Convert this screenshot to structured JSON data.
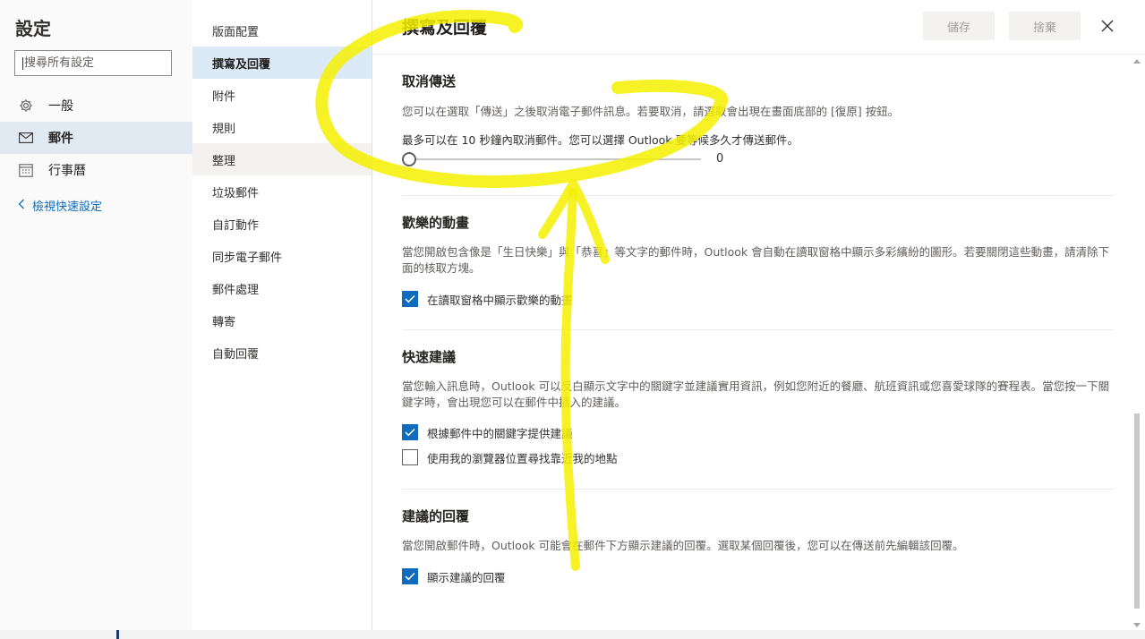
{
  "sidebar": {
    "title": "設定",
    "search_placeholder": "搜尋所有設定",
    "items": [
      {
        "label": "一般",
        "icon": "gear-icon"
      },
      {
        "label": "郵件",
        "icon": "mail-icon"
      },
      {
        "label": "行事曆",
        "icon": "calendar-icon"
      }
    ],
    "quick_settings": "檢視快速設定"
  },
  "mail_nav": {
    "items": [
      "版面配置",
      "撰寫及回覆",
      "附件",
      "規則",
      "整理",
      "垃圾郵件",
      "自訂動作",
      "同步電子郵件",
      "郵件處理",
      "轉寄",
      "自動回覆"
    ]
  },
  "pane": {
    "title": "撰寫及回覆",
    "save_label": "儲存",
    "discard_label": "捨棄"
  },
  "undo_send": {
    "heading": "取消傳送",
    "desc": "您可以在選取「傳送」之後取消電子郵件訊息。若要取消，請選取會出現在畫面底部的 [復原] 按鈕。",
    "limit": "最多可以在 10 秒鐘內取消郵件。您可以選擇 Outlook 要等候多久才傳送郵件。",
    "value": "0",
    "value_fraction": 0
  },
  "celebration": {
    "heading": "歡樂的動畫",
    "desc": "當您開啟包含像是「生日快樂」與「恭喜」等文字的郵件時，Outlook 會自動在讀取窗格中顯示多彩繽紛的圖形。若要關閉這些動畫，請清除下面的核取方塊。",
    "checkbox": "在讀取窗格中顯示歡樂的動畫",
    "checked": true
  },
  "suggestions": {
    "heading": "快速建議",
    "desc": "當您輸入訊息時，Outlook 可以反白顯示文字中的關鍵字並建議實用資訊，例如您附近的餐廳、航班資訊或您喜愛球隊的賽程表。當您按一下關鍵字時，會出現您可以在郵件中插入的建議。",
    "opt1": "根據郵件中的關鍵字提供建議",
    "opt1_checked": true,
    "opt2": "使用我的瀏覽器位置尋找靠近我的地點",
    "opt2_checked": false
  },
  "replies": {
    "heading": "建議的回覆",
    "desc": "當您開啟郵件時，Outlook 可能會在郵件下方顯示建議的回覆。選取某個回覆後，您可以在傳送前先編輯該回覆。",
    "checkbox": "顯示建議的回覆",
    "checked": true
  },
  "colors": {
    "accent": "#0f6cbd",
    "highlighter": "#f5f000"
  }
}
